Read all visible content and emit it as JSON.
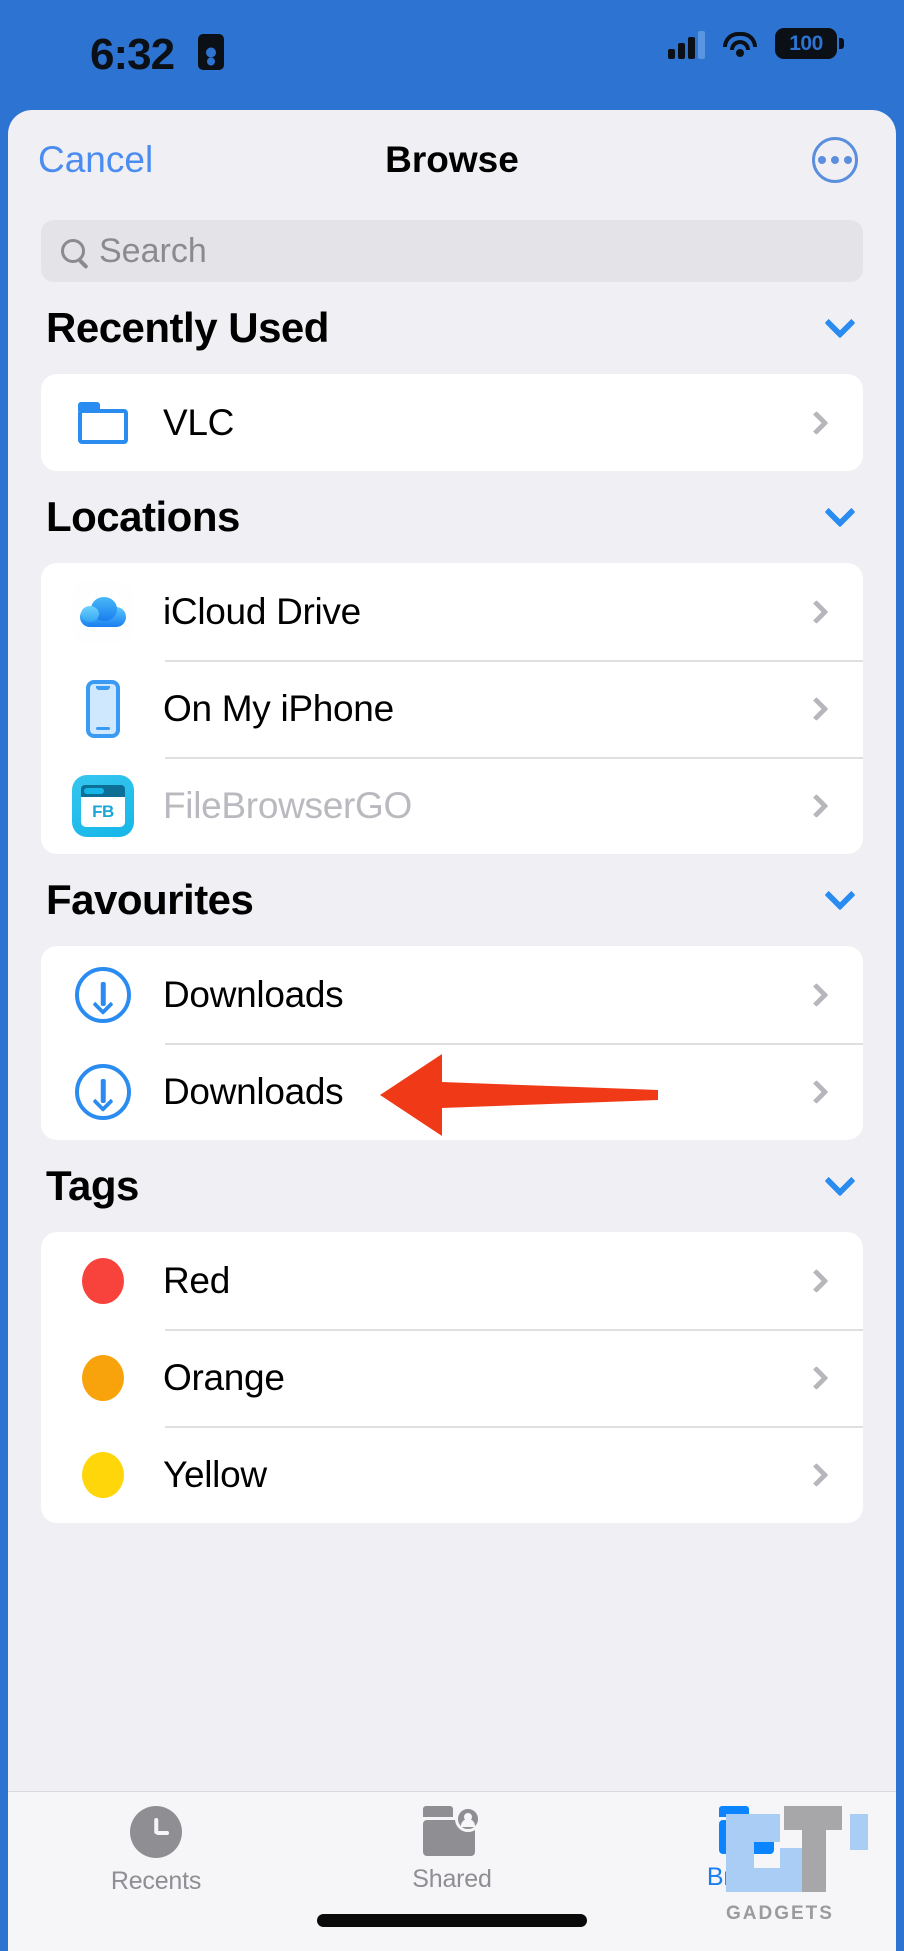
{
  "status_bar": {
    "time": "6:32",
    "lock_icon": "lock-portrait-icon",
    "signal_icon": "cellular-signal-icon",
    "wifi_icon": "wifi-icon",
    "battery_level": "100",
    "battery_icon": "battery-full-icon"
  },
  "nav": {
    "cancel_label": "Cancel",
    "title": "Browse",
    "more_icon": "ellipsis-circle-icon"
  },
  "search": {
    "placeholder": "Search",
    "value": "",
    "icon": "search-icon"
  },
  "sections": [
    {
      "title": "Recently Used",
      "collapse_icon": "chevron-down-icon",
      "rows": [
        {
          "label": "VLC",
          "icon": "folder-outline-icon",
          "disabled": false
        }
      ]
    },
    {
      "title": "Locations",
      "collapse_icon": "chevron-down-icon",
      "rows": [
        {
          "label": "iCloud Drive",
          "icon": "icloud-drive-icon",
          "disabled": false
        },
        {
          "label": "On My iPhone",
          "icon": "iphone-icon",
          "disabled": false
        },
        {
          "label": "FileBrowserGO",
          "icon": "filebrowsergo-app-icon",
          "icon_text": "FB",
          "disabled": true
        }
      ]
    },
    {
      "title": "Favourites",
      "collapse_icon": "chevron-down-icon",
      "rows": [
        {
          "label": "Downloads",
          "icon": "download-circle-icon",
          "disabled": false,
          "annotated": true
        },
        {
          "label": "Downloads",
          "icon": "download-circle-icon",
          "disabled": false
        }
      ]
    },
    {
      "title": "Tags",
      "collapse_icon": "chevron-down-icon",
      "rows": [
        {
          "label": "Red",
          "icon": "tag-dot-icon",
          "color": "#f8423c"
        },
        {
          "label": "Orange",
          "icon": "tag-dot-icon",
          "color": "#f8a30c"
        },
        {
          "label": "Yellow",
          "icon": "tag-dot-icon",
          "color": "#ffd60a"
        }
      ]
    }
  ],
  "tabs": [
    {
      "label": "Recents",
      "icon": "clock-icon",
      "active": false
    },
    {
      "label": "Shared",
      "icon": "shared-folder-icon",
      "active": false
    },
    {
      "label": "Browse",
      "icon": "folder-icon",
      "active": true
    }
  ],
  "annotation": {
    "type": "arrow-left",
    "color": "#f03a17"
  },
  "watermark": {
    "label": "GADGETS",
    "logo": "gt-logo"
  },
  "colors": {
    "accent": "#0a84ff",
    "sheet_background": "#f0f0f4",
    "card_background": "#ffffff",
    "wallpaper": "#2d73d2",
    "disabled_text": "#b9b9bf"
  }
}
